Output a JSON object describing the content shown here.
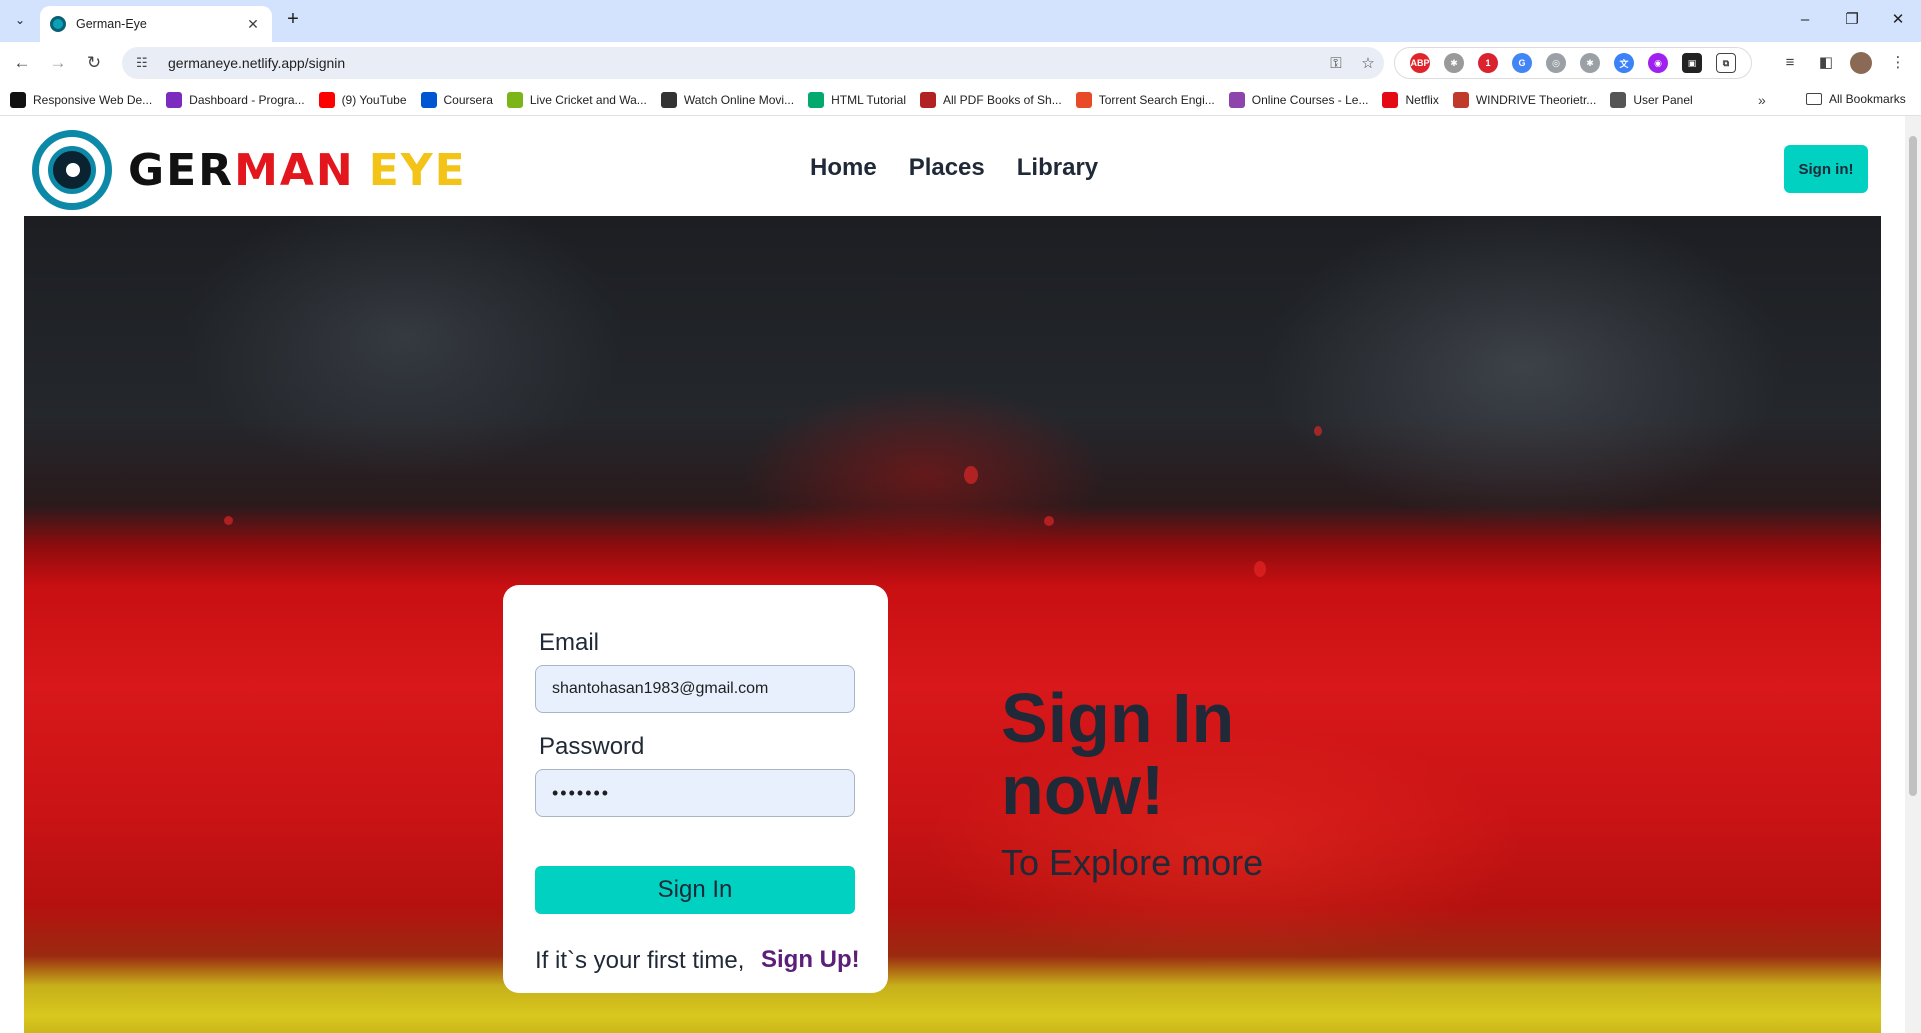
{
  "browser": {
    "tab_title": "German-Eye",
    "url": "germaneye.netlify.app/signin",
    "bookmarks": [
      {
        "label": "Responsive Web De...",
        "icon": "codepen-icon",
        "color": "#111111"
      },
      {
        "label": "Dashboard - Progra...",
        "icon": "dashboard-icon",
        "color": "#7b2cbf"
      },
      {
        "label": "(9) YouTube",
        "icon": "youtube-icon",
        "color": "#ff0000"
      },
      {
        "label": "Coursera",
        "icon": "coursera-icon",
        "color": "#0056d2"
      },
      {
        "label": "Live Cricket and Wa...",
        "icon": "cricket-icon",
        "color": "#7cb518"
      },
      {
        "label": "Watch Online Movi...",
        "icon": "movie-icon",
        "color": "#333333"
      },
      {
        "label": "HTML Tutorial",
        "icon": "w3schools-icon",
        "color": "#04aa6d"
      },
      {
        "label": "All PDF Books of Sh...",
        "icon": "book-icon",
        "color": "#b22222"
      },
      {
        "label": "Torrent Search Engi...",
        "icon": "torrent-icon",
        "color": "#e84a27"
      },
      {
        "label": "Online Courses - Le...",
        "icon": "courses-icon",
        "color": "#8e44ad"
      },
      {
        "label": "Netflix",
        "icon": "netflix-icon",
        "color": "#e50914"
      },
      {
        "label": "WINDRIVE Theorietr...",
        "icon": "windrive-icon",
        "color": "#c0392b"
      },
      {
        "label": "User Panel",
        "icon": "globe-icon",
        "color": "#555555"
      }
    ],
    "all_bookmarks": "All Bookmarks"
  },
  "site": {
    "logo_part1": "GER",
    "logo_part2": "MAN",
    "logo_part3": "EYE",
    "nav": [
      "Home",
      "Places",
      "Library"
    ],
    "header_signin": "Sign in!"
  },
  "form": {
    "email_label": "Email",
    "email_value": "shantohasan1983@gmail.com",
    "password_label": "Password",
    "password_value": "•••••••",
    "submit_label": "Sign In",
    "first_time_text": "If it`s your first time,",
    "signup_label": "Sign Up!"
  },
  "hero": {
    "heading": "Sign In now!",
    "subheading": "To Explore more"
  },
  "colors": {
    "accent": "#00d1c1",
    "signup_link": "#5b1f7a",
    "logo_red": "#e3161d",
    "logo_yellow": "#f3c318"
  }
}
